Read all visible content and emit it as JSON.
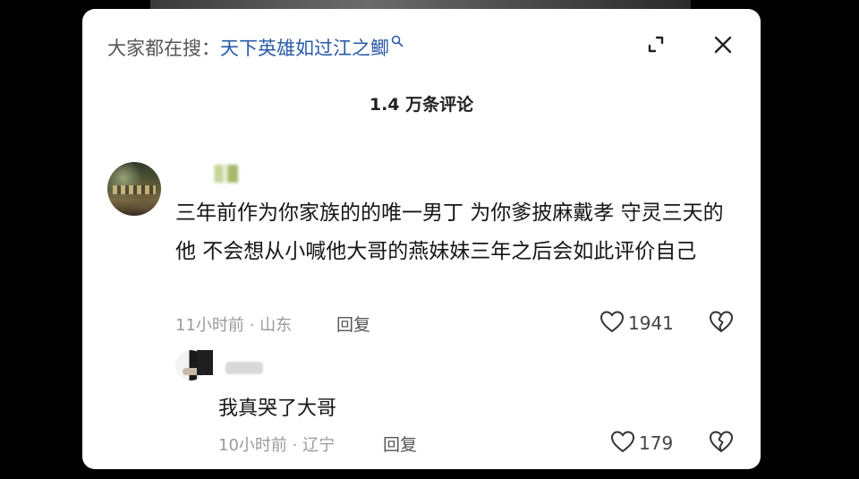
{
  "search": {
    "prefix": "大家都在搜：",
    "term": "天下英雄如过江之鲫"
  },
  "header": {
    "count_title": "1.4 万条评论"
  },
  "comment": {
    "text": "三年前作为你家族的的唯一男丁 为你爹披麻戴孝 守灵三天的他 不会想从小喊他大哥的燕妹妹三年之后会如此评价自己",
    "meta": "11小时前 · 山东",
    "reply_label": "回复",
    "likes": "1941"
  },
  "reply": {
    "text": "我真哭了大哥",
    "meta": "10小时前 · 辽宁",
    "reply_label": "回复",
    "likes": "179"
  },
  "icons": {
    "search": "search-icon",
    "collapse": "collapse-icon",
    "close": "close-icon",
    "like": "heart-icon",
    "dislike": "broken-heart-icon"
  },
  "colors": {
    "search_term": "#2a5aa8",
    "meta_text": "#9a9a9a",
    "panel_bg": "#ffffff"
  }
}
